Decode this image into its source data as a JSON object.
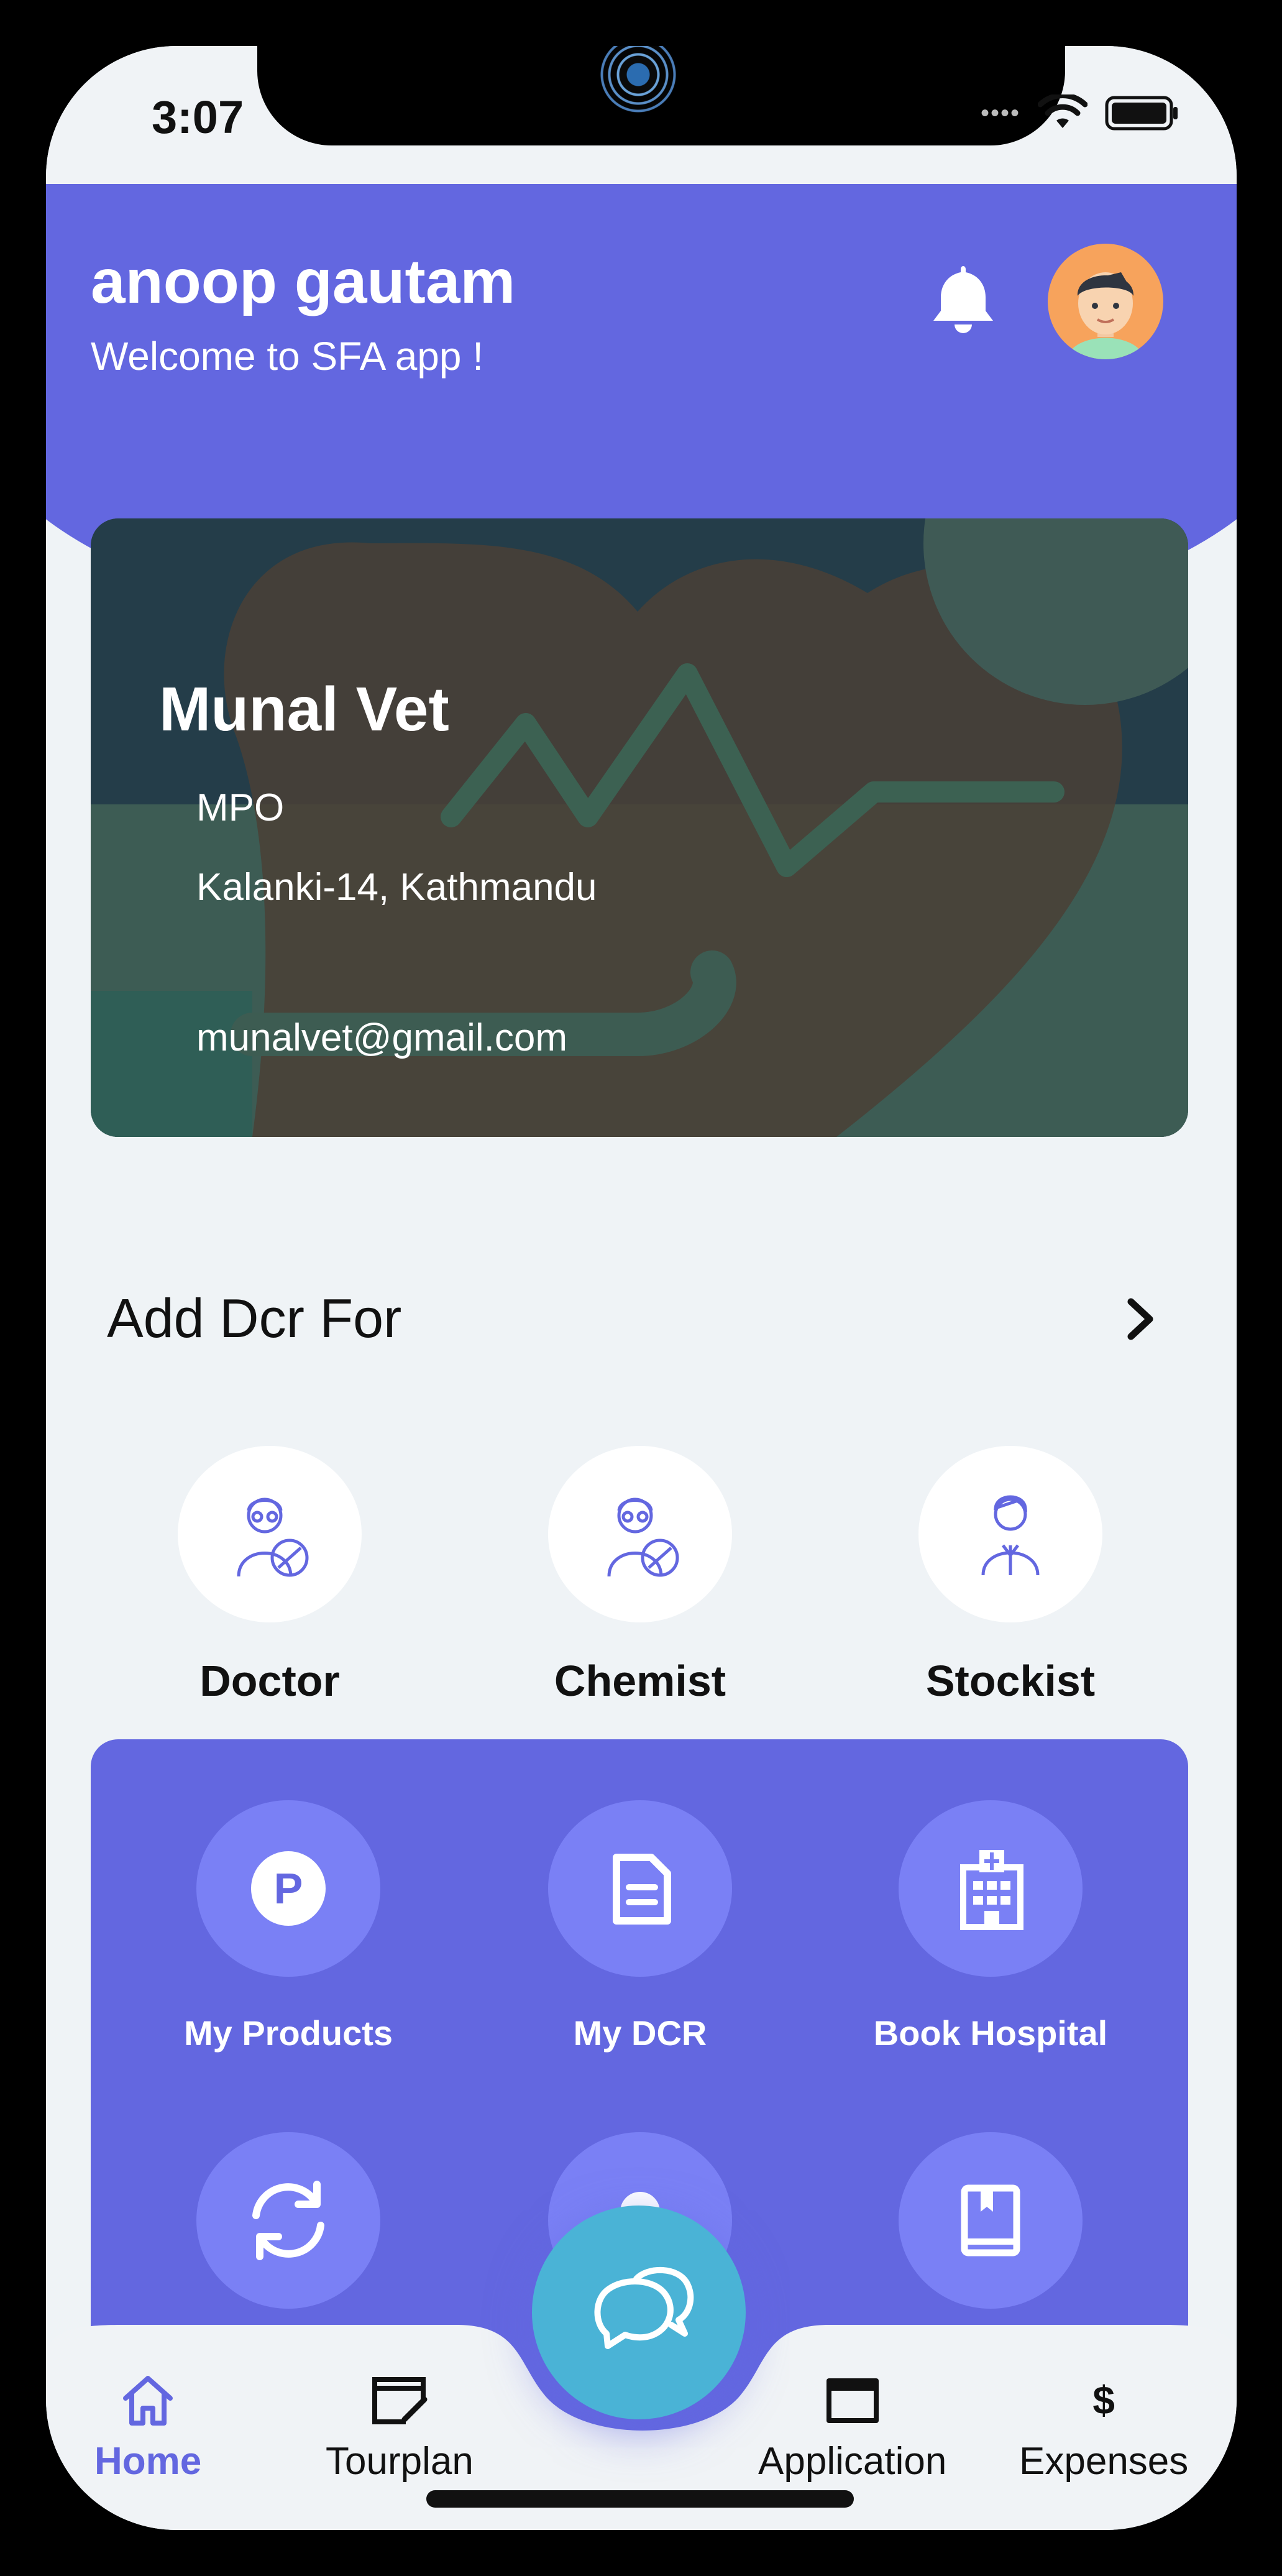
{
  "status": {
    "time": "3:07"
  },
  "header": {
    "user_name": "anoop gautam",
    "welcome": "Welcome to SFA app !"
  },
  "card": {
    "name": "Munal Vet",
    "role": "MPO",
    "address": "Kalanki-14, Kathmandu",
    "email": "munalvet@gmail.com"
  },
  "dcr": {
    "title": "Add Dcr For",
    "items": [
      {
        "label": "Doctor",
        "icon": "doctor-icon"
      },
      {
        "label": "Chemist",
        "icon": "chemist-icon"
      },
      {
        "label": "Stockist",
        "icon": "stockist-icon"
      }
    ]
  },
  "menu": {
    "items": [
      {
        "label": "My Products",
        "icon": "products-icon"
      },
      {
        "label": "My DCR",
        "icon": "document-icon"
      },
      {
        "label": "Book Hospital",
        "icon": "hospital-icon"
      },
      {
        "label": "",
        "icon": "sync-icon"
      },
      {
        "label": "",
        "icon": "user-icon"
      },
      {
        "label": "",
        "icon": "book-icon"
      }
    ]
  },
  "nav": {
    "items": [
      {
        "label": "Home",
        "icon": "home-icon",
        "active": true
      },
      {
        "label": "Tourplan",
        "icon": "calendar-edit-icon"
      },
      {
        "label": "Application",
        "icon": "window-icon"
      },
      {
        "label": "Expenses",
        "icon": "dollar-icon"
      }
    ],
    "fab_icon": "chat-icon"
  },
  "colors": {
    "primary": "#6367e0",
    "menu_circle": "#7a80f5",
    "fab": "#4ab3d6",
    "background": "#eff3f6"
  }
}
